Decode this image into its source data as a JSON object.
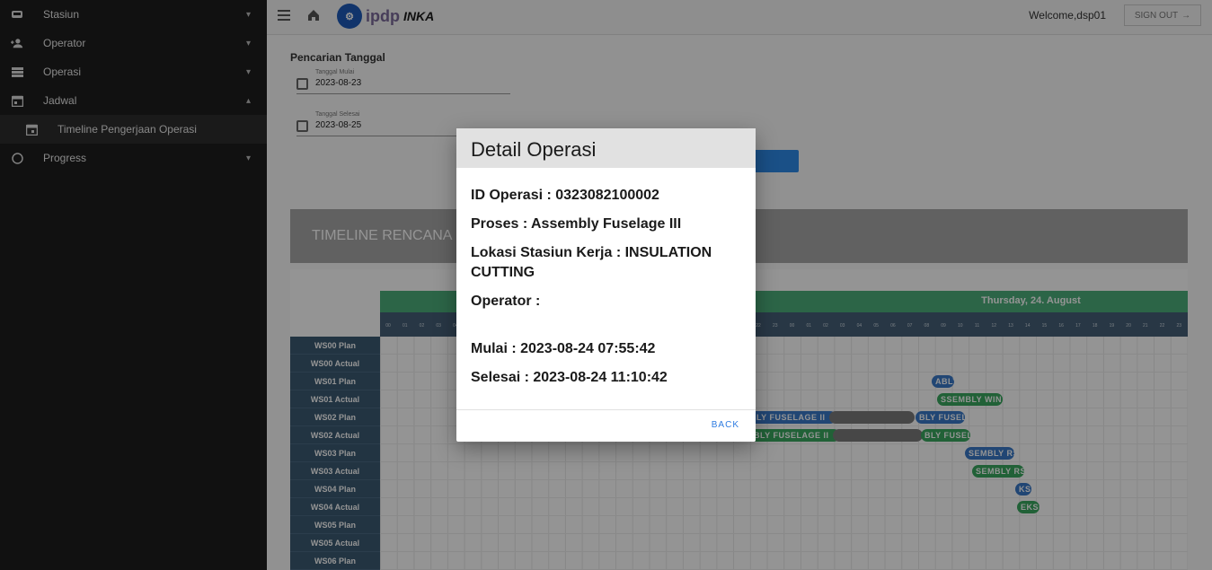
{
  "sidebar": {
    "items": [
      {
        "label": "Stasiun",
        "icon": "train-icon"
      },
      {
        "label": "Operator",
        "icon": "person-add-icon"
      },
      {
        "label": "Operasi",
        "icon": "list-icon"
      },
      {
        "label": "Jadwal",
        "icon": "calendar-icon"
      },
      {
        "label": "Timeline Pengerjaan Operasi",
        "icon": "calendar-icon"
      },
      {
        "label": "Progress",
        "icon": "circle-icon"
      }
    ]
  },
  "topbar": {
    "welcome": "Welcome,dsp01",
    "signout_label": "SIGN OUT",
    "logo_ipdp": "ipdp",
    "logo_inka": "INKA"
  },
  "search": {
    "title": "Pencarian Tanggal",
    "start_label": "Tanggal Mulai",
    "start_value": "2023-08-23",
    "end_label": "Tanggal Selesai",
    "end_value": "2023-08-25"
  },
  "timeline": {
    "title": "TIMELINE RENCANA P",
    "day_label": "Thursday, 24. August",
    "hours": [
      "00",
      "01",
      "02",
      "03",
      "04",
      "05",
      "06",
      "07",
      "08",
      "09",
      "10",
      "11",
      "12",
      "13",
      "14",
      "15",
      "16",
      "17",
      "18",
      "19",
      "20",
      "21",
      "22",
      "23",
      "00",
      "01",
      "02",
      "03",
      "04",
      "05",
      "06",
      "07",
      "08",
      "09",
      "10",
      "11",
      "12",
      "13",
      "14",
      "15",
      "16",
      "17",
      "18",
      "19",
      "20",
      "21",
      "22",
      "23"
    ],
    "rows": [
      "WS00 Plan",
      "WS00 Actual",
      "WS01 Plan",
      "WS01 Actual",
      "WS02 Plan",
      "WS02 Actual",
      "WS03 Plan",
      "WS03 Actual",
      "WS04 Plan",
      "WS04 Actual",
      "WS05 Plan",
      "WS05 Actual",
      "WS06 Plan"
    ],
    "bars": [
      {
        "text": "ABLY",
        "row": 2,
        "type": "plan"
      },
      {
        "text": "SSEMBLY WIN",
        "row": 3,
        "type": "actual"
      },
      {
        "text": "BLY FUSELAGE II",
        "row": 4,
        "type": "plan"
      },
      {
        "text": "",
        "row": 4,
        "type": "gray"
      },
      {
        "text": "BLY FUSEL",
        "row": 4,
        "type": "plan"
      },
      {
        "text": "BLY FUSELAGE II",
        "row": 5,
        "type": "actual"
      },
      {
        "text": "",
        "row": 5,
        "type": "gray"
      },
      {
        "text": "BLY FUSEL",
        "row": 5,
        "type": "actual"
      },
      {
        "text": "SEMBLY RS",
        "row": 6,
        "type": "plan"
      },
      {
        "text": "SEMBLY RS",
        "row": 7,
        "type": "actual"
      },
      {
        "text": "KS",
        "row": 8,
        "type": "plan"
      },
      {
        "text": "EKSI",
        "row": 9,
        "type": "actual"
      }
    ]
  },
  "modal": {
    "title": "Detail Operasi",
    "id_line": "ID Operasi : 0323082100002",
    "proses_line": "Proses : Assembly Fuselage III",
    "lokasi_line": "Lokasi Stasiun Kerja : INSULATION CUTTING",
    "operator_line": "Operator :",
    "mulai_line": "Mulai : 2023-08-24 07:55:42",
    "selesai_line": "Selesai : 2023-08-24 11:10:42",
    "back_label": "BACK"
  },
  "colors": {
    "sidebar_bg": "#1e1e1e",
    "accent_blue": "#2d8be8",
    "day_band": "#4caf7a",
    "hour_band": "#456078",
    "plan_bar": "#3a79c8",
    "actual_bar": "#3aa860"
  }
}
